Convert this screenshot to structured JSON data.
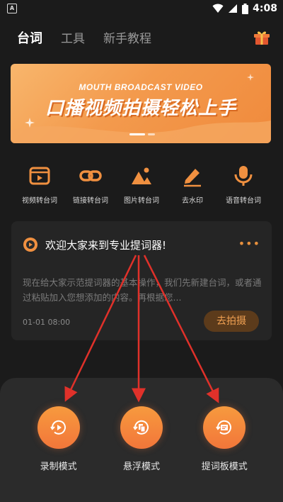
{
  "status_bar": {
    "time": "4:08",
    "notification": "A"
  },
  "top_tabs": [
    {
      "label": "台词",
      "active": true
    },
    {
      "label": "工具",
      "active": false
    },
    {
      "label": "新手教程",
      "active": false
    }
  ],
  "banner": {
    "subtitle": "MOUTH BROADCAST VIDEO",
    "title": "口播视频拍摄轻松上手"
  },
  "tools": [
    {
      "label": "视频转台词",
      "icon": "video-icon"
    },
    {
      "label": "链接转台词",
      "icon": "link-icon"
    },
    {
      "label": "图片转台词",
      "icon": "image-icon"
    },
    {
      "label": "去水印",
      "icon": "edit-icon"
    },
    {
      "label": "语音转台词",
      "icon": "mic-icon"
    }
  ],
  "card": {
    "title": "欢迎大家来到专业提词器!",
    "more": "•••",
    "body": "现在给大家示范提词器的基本操作，我们先新建台词，或者通过粘贴加入您想添加的内容。再根据您...",
    "date": "01-01 08:00",
    "action": "去拍摄"
  },
  "modes": [
    {
      "label": "录制模式",
      "icon": "record-icon"
    },
    {
      "label": "悬浮模式",
      "icon": "float-icon"
    },
    {
      "label": "提词板模式",
      "icon": "board-icon"
    }
  ],
  "colors": {
    "accent": "#f2763a",
    "arrow": "#e0312a",
    "background": "#1b1b1b"
  }
}
